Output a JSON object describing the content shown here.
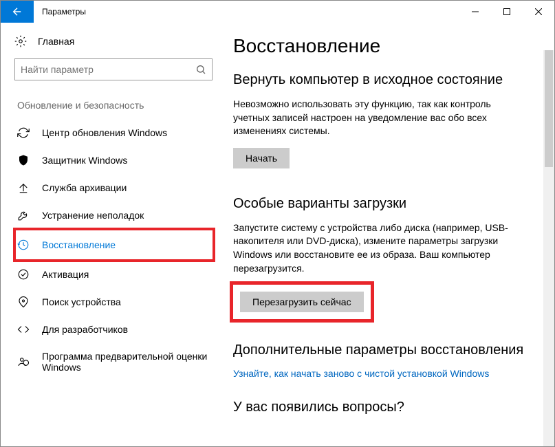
{
  "titlebar": {
    "title": "Параметры"
  },
  "home": {
    "label": "Главная"
  },
  "search": {
    "placeholder": "Найти параметр"
  },
  "group": {
    "header": "Обновление и безопасность"
  },
  "nav": {
    "items": [
      {
        "label": "Центр обновления Windows"
      },
      {
        "label": "Защитник Windows"
      },
      {
        "label": "Служба архивации"
      },
      {
        "label": "Устранение неполадок"
      },
      {
        "label": "Восстановление"
      },
      {
        "label": "Активация"
      },
      {
        "label": "Поиск устройства"
      },
      {
        "label": "Для разработчиков"
      },
      {
        "label": "Программа предварительной оценки Windows"
      }
    ]
  },
  "main": {
    "title": "Восстановление",
    "reset": {
      "heading": "Вернуть компьютер в исходное состояние",
      "desc": "Невозможно использовать эту функцию, так как контроль учетных записей настроен на уведомление вас обо всех изменениях системы.",
      "button": "Начать"
    },
    "advanced": {
      "heading": "Особые варианты загрузки",
      "desc": "Запустите систему с устройства либо диска (например, USB-накопителя или DVD-диска), измените параметры загрузки Windows или восстановите ее из образа. Ваш компьютер перезагрузится.",
      "button": "Перезагрузить сейчас"
    },
    "more": {
      "heading": "Дополнительные параметры восстановления",
      "link": "Узнайте, как начать заново с чистой установкой Windows"
    },
    "questions": {
      "heading": "У вас появились вопросы?"
    }
  }
}
